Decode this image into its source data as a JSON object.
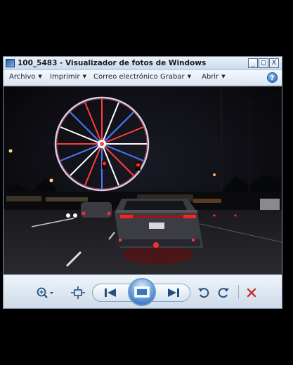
{
  "window": {
    "title": "100_5483 - Visualizador de fotos de Windows",
    "controls": [
      "_",
      "□",
      "X"
    ]
  },
  "menu": {
    "items": [
      {
        "label": "Archivo",
        "icon": "chevron-down-icon"
      },
      {
        "label": "Imprimir",
        "icon": "chevron-down-icon"
      },
      {
        "label": "Correo electrónico"
      },
      {
        "label": "Grabar",
        "icon": "chevron-down-icon"
      },
      {
        "label": "Abrir",
        "icon": "chevron-down-icon"
      }
    ],
    "help_icon": "?"
  },
  "photo": {
    "description_icon": "night-street-ferris-wheel-photo"
  },
  "toolbar": {
    "buttons": [
      "zoom-icon",
      "actual-size-icon",
      "previous-icon",
      "slideshow-icon",
      "next-icon",
      "rotate-left-icon",
      "rotate-right-icon",
      "delete-icon"
    ]
  },
  "colors": {
    "accent": "#2a63b0",
    "delete": "#c0392b"
  }
}
